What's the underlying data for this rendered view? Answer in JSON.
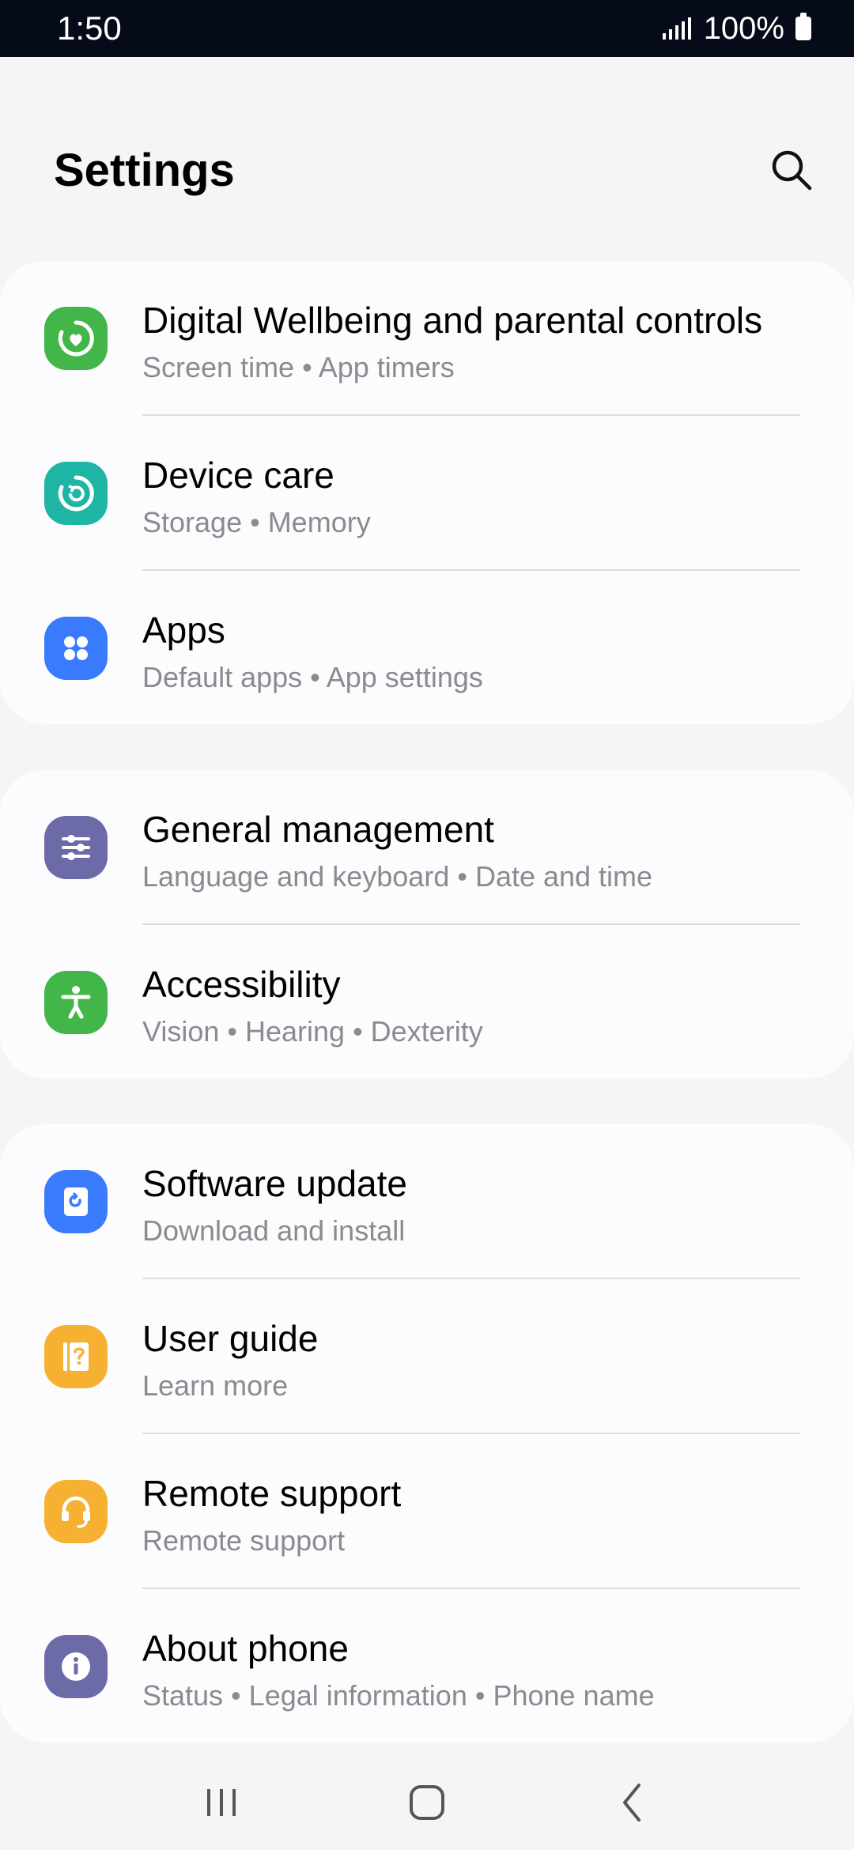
{
  "status_bar": {
    "time": "1:50",
    "battery": "100%"
  },
  "header": {
    "title": "Settings",
    "search_icon": "search-icon"
  },
  "colors": {
    "wellbeing": "#43b649",
    "device_care": "#1eb5a4",
    "apps": "#3a7bfd",
    "general_management": "#6d6aa8",
    "accessibility": "#43b649",
    "software_update": "#3a7bfd",
    "user_guide": "#f6b032",
    "remote_support": "#f6b032",
    "about_phone": "#6d6aa8"
  },
  "groups": [
    {
      "items": [
        {
          "title": "Digital Wellbeing and parental controls",
          "subtitle": "Screen time  •  App timers",
          "icon": "digital-wellbeing-icon"
        },
        {
          "title": "Device care",
          "subtitle": "Storage  •  Memory",
          "icon": "device-care-icon"
        },
        {
          "title": "Apps",
          "subtitle": "Default apps  •  App settings",
          "icon": "apps-icon"
        }
      ]
    },
    {
      "items": [
        {
          "title": "General management",
          "subtitle": "Language and keyboard  •  Date and time",
          "icon": "sliders-icon"
        },
        {
          "title": "Accessibility",
          "subtitle": "Vision  •  Hearing  •  Dexterity",
          "icon": "accessibility-icon"
        }
      ]
    },
    {
      "items": [
        {
          "title": "Software update",
          "subtitle": "Download and install",
          "icon": "software-update-icon"
        },
        {
          "title": "User guide",
          "subtitle": "Learn more",
          "icon": "user-guide-icon"
        },
        {
          "title": "Remote support",
          "subtitle": "Remote support",
          "icon": "headset-icon"
        },
        {
          "title": "About phone",
          "subtitle": "Status  •  Legal information  •  Phone name",
          "icon": "info-icon"
        }
      ]
    }
  ],
  "nav_bar": {
    "recents": "recents-icon",
    "home": "home-icon",
    "back": "back-icon"
  }
}
